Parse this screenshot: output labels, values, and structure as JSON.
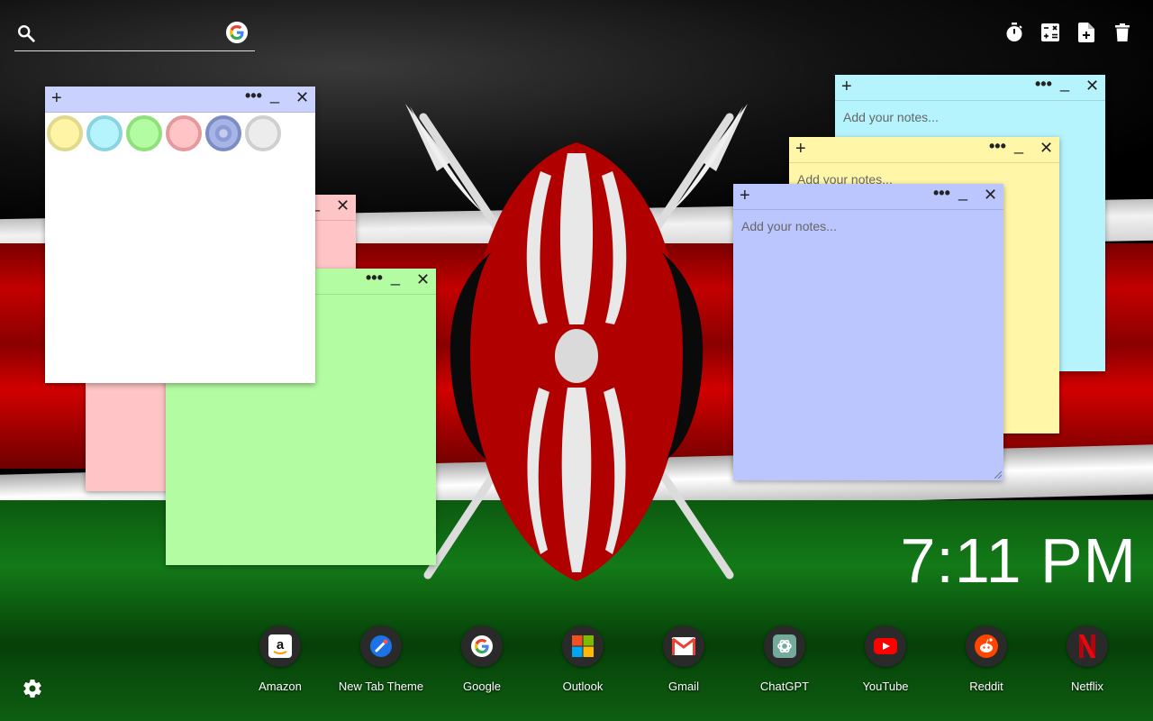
{
  "search": {
    "placeholder": "",
    "value": ""
  },
  "toolbar": {
    "icons": [
      "timer-icon",
      "calculator-icon",
      "new-note-icon",
      "trash-icon"
    ]
  },
  "notes": {
    "placeholder": "Add your notes...",
    "plus_label": "+",
    "menu_label": "•••",
    "minimize_label": "_",
    "close_label": "✕",
    "colors": {
      "white": "#ffffff",
      "pink": "#ffc5c6",
      "green": "#b3fca1",
      "cyan": "#b5f3fd",
      "yellow": "#fff6a8",
      "periwinkle": "#bac6fd",
      "bar_white": "#c9d2fe"
    }
  },
  "palette": {
    "swatches": [
      {
        "name": "yellow",
        "fill": "#fff3a6",
        "ring": "#e0d98b"
      },
      {
        "name": "cyan",
        "fill": "#b5f3fd",
        "ring": "#8ad3e0"
      },
      {
        "name": "green",
        "fill": "#b3fca1",
        "ring": "#8ee07a"
      },
      {
        "name": "pink",
        "fill": "#ffc5c6",
        "ring": "#e49a9d"
      },
      {
        "name": "periwinkle",
        "fill": "#a6b5e6",
        "ring": "#7d8cc4"
      },
      {
        "name": "gray",
        "fill": "#ececec",
        "ring": "#cfcfcf"
      }
    ]
  },
  "clock": {
    "time": "7:11 PM"
  },
  "shortcuts": [
    {
      "label": "Amazon",
      "icon": "amazon-icon"
    },
    {
      "label": "New Tab Theme",
      "icon": "new-tab-theme-icon"
    },
    {
      "label": "Google",
      "icon": "google-icon"
    },
    {
      "label": "Outlook",
      "icon": "outlook-icon"
    },
    {
      "label": "Gmail",
      "icon": "gmail-icon"
    },
    {
      "label": "ChatGPT",
      "icon": "chatgpt-icon"
    },
    {
      "label": "YouTube",
      "icon": "youtube-icon"
    },
    {
      "label": "Reddit",
      "icon": "reddit-icon"
    },
    {
      "label": "Netflix",
      "icon": "netflix-icon"
    }
  ]
}
